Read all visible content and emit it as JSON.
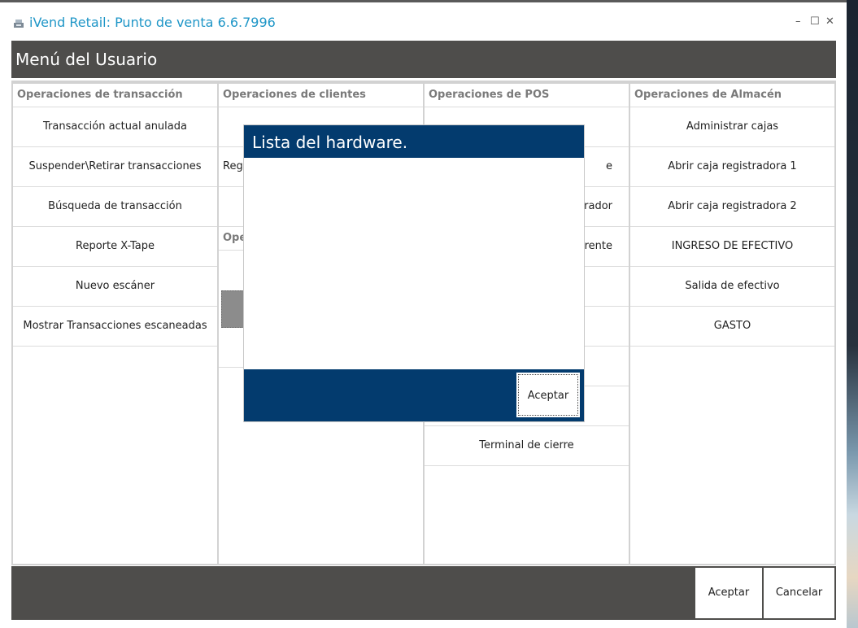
{
  "window": {
    "title": "iVend Retail: Punto de venta 6.6.7996",
    "minimize_symbol": "–",
    "maximize_symbol": "☐",
    "close_symbol": "✕",
    "icon": "pos-register-icon"
  },
  "header": {
    "title": "Menú del Usuario"
  },
  "columns": {
    "transactions": {
      "header": "Operaciones de transacción",
      "items": [
        "Transacción actual anulada",
        "Suspender\\Retirar transacciones",
        "Búsqueda de transacción",
        "Reporte X-Tape",
        "Nuevo escáner",
        "Mostrar Transacciones escaneadas"
      ]
    },
    "clients": {
      "header": "Operaciones de clientes",
      "items": [
        "",
        "Regi",
        ""
      ],
      "sub_header": "Oper"
    },
    "pos": {
      "header": "Operaciones de POS",
      "items": [
        "",
        "e",
        "trador",
        "erente",
        "",
        "",
        "",
        "",
        "Terminal de cierre"
      ]
    },
    "warehouse": {
      "header": "Operaciones de Almacén",
      "items": [
        "Administrar cajas",
        "Abrir caja registradora 1",
        "Abrir caja registradora 2",
        "INGRESO DE EFECTIVO",
        "Salida de efectivo",
        "GASTO"
      ]
    }
  },
  "footer": {
    "accept_label": "Aceptar",
    "cancel_label": "Cancelar"
  },
  "dialog": {
    "title": "Lista del hardware.",
    "accept_label": "Aceptar"
  },
  "colors": {
    "header_bg": "#4e4d4b",
    "dialog_bg": "#033b6e",
    "title_text": "#1f96c7"
  }
}
